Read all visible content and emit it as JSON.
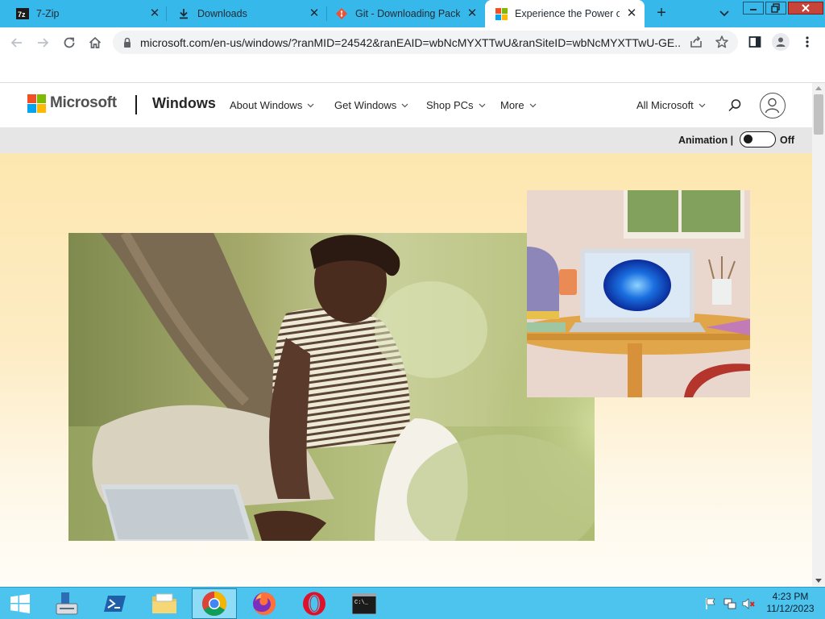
{
  "browser": {
    "tabs": [
      {
        "title": "7-Zip",
        "icon": "7zip-favicon-icon",
        "active": false
      },
      {
        "title": "Downloads",
        "icon": "download-favicon-icon",
        "active": false
      },
      {
        "title": "Git - Downloading Packa",
        "icon": "git-favicon-icon",
        "active": false
      },
      {
        "title": "Experience the Power of",
        "icon": "microsoft-favicon-icon",
        "active": true
      }
    ],
    "url": "microsoft.com/en-us/windows/?ranMID=24542&ranEAID=wbNcMYXTTwU&ranSiteID=wbNcMYXTTwU-GE..."
  },
  "site": {
    "brand": "Microsoft",
    "product": "Windows",
    "nav": [
      {
        "label": "About Windows"
      },
      {
        "label": "Get Windows"
      },
      {
        "label": "Shop PCs"
      },
      {
        "label": "More"
      }
    ],
    "all_microsoft": "All Microsoft",
    "animation_label": "Animation |",
    "animation_state": "Off"
  },
  "taskbar": {
    "apps": [
      "windows-start-icon",
      "server-manager-icon",
      "powershell-icon",
      "file-explorer-icon",
      "chrome-icon",
      "firefox-icon",
      "opera-icon",
      "command-prompt-icon"
    ],
    "time": "4:23 PM",
    "date": "11/12/2023"
  },
  "colors": {
    "tabstrip": "#37b8eb",
    "taskbar": "#4cc4ee",
    "hero_top": "#fde7b0",
    "ms_red": "#f25022",
    "ms_green": "#7fba00",
    "ms_blue": "#00a4ef",
    "ms_yellow": "#ffb900"
  }
}
